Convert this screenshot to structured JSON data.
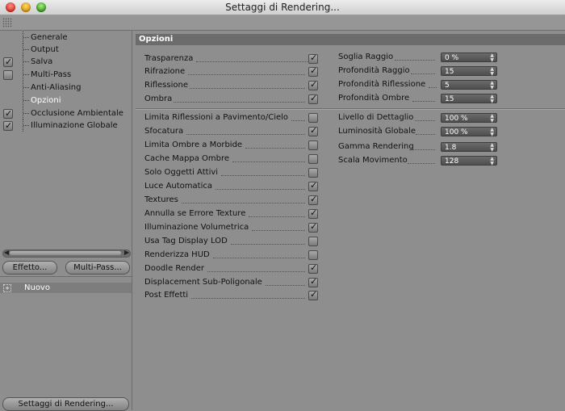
{
  "window": {
    "title": "Settaggi di Rendering..."
  },
  "sidebar": {
    "items": [
      {
        "label": "Generale",
        "checkbox": null
      },
      {
        "label": "Output",
        "checkbox": null
      },
      {
        "label": "Salva",
        "checkbox": true
      },
      {
        "label": "Multi-Pass",
        "checkbox": false
      },
      {
        "label": "Anti-Aliasing",
        "checkbox": null
      },
      {
        "label": "Opzioni",
        "checkbox": null,
        "selected": true
      },
      {
        "label": "Occlusione Ambientale",
        "checkbox": true
      },
      {
        "label": "Illuminazione Globale",
        "checkbox": true
      }
    ],
    "effect_button": "Effetto...",
    "multipass_button": "Multi-Pass...",
    "tree_item": "Nuovo",
    "render_settings_button": "Settaggi di Rendering..."
  },
  "main": {
    "section_title": "Opzioni",
    "top_left": [
      {
        "label": "Trasparenza",
        "checked": true
      },
      {
        "label": "Rifrazione",
        "checked": true
      },
      {
        "label": "Riflessione",
        "checked": true
      },
      {
        "label": "Ombra",
        "checked": true
      }
    ],
    "top_right": [
      {
        "label": "Soglia Raggio",
        "value": "0 %"
      },
      {
        "label": "Profondità Raggio",
        "value": "15"
      },
      {
        "label": "Profondità Riflessione",
        "value": "5"
      },
      {
        "label": "Profondità Ombre",
        "value": "15"
      }
    ],
    "bottom_left": [
      {
        "label": "Limita Riflessioni a Pavimento/Cielo",
        "checked": false
      },
      {
        "label": "Sfocatura",
        "checked": true
      },
      {
        "label": "Limita Ombre a Morbide",
        "checked": false
      },
      {
        "label": "Cache Mappa Ombre",
        "checked": false
      },
      {
        "label": "Solo Oggetti Attivi",
        "checked": false
      },
      {
        "label": "Luce Automatica",
        "checked": true
      },
      {
        "label": "Textures",
        "checked": true
      },
      {
        "label": "Annulla se Errore Texture",
        "checked": true
      },
      {
        "label": "Illuminazione Volumetrica",
        "checked": true
      },
      {
        "label": "Usa Tag Display LOD",
        "checked": false
      },
      {
        "label": "Renderizza HUD",
        "checked": false
      },
      {
        "label": "Doodle Render",
        "checked": true
      },
      {
        "label": "Displacement Sub-Poligonale",
        "checked": true
      },
      {
        "label": "Post Effetti",
        "checked": true
      }
    ],
    "bottom_right": [
      {
        "label": "Livello di Dettaglio",
        "value": "100 %"
      },
      {
        "label": "Luminosità Globale",
        "value": "100 %"
      },
      {
        "label": "Gamma Rendering",
        "value": "1.8"
      },
      {
        "label": "Scala Movimento",
        "value": "128"
      }
    ]
  }
}
